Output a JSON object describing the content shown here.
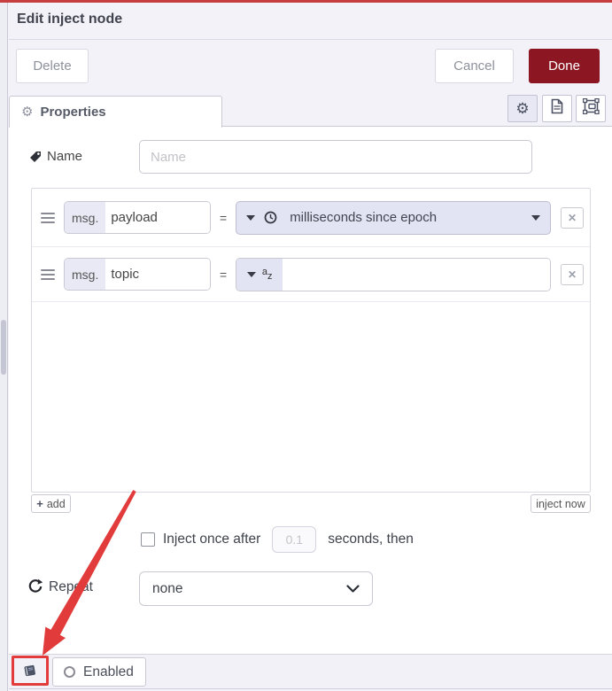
{
  "window": {
    "title": "Edit inject node"
  },
  "buttons": {
    "delete": "Delete",
    "cancel": "Cancel",
    "done": "Done"
  },
  "tab": {
    "label": "Properties"
  },
  "name_row": {
    "label": "Name",
    "placeholder": "Name"
  },
  "rules": {
    "rows": [
      {
        "prefix": "msg.",
        "property": "payload",
        "equals": "=",
        "type_label": "milliseconds since epoch"
      },
      {
        "prefix": "msg.",
        "property": "topic",
        "equals": "=",
        "value": ""
      }
    ],
    "remove_glyph": "✕",
    "plus_glyph": "+",
    "add_label": "add",
    "inject_now_label": "inject now",
    "az_top": "a",
    "az_bottom": "z",
    "gear_glyph": "⚙"
  },
  "inject_once": {
    "label_before": "Inject once after",
    "delay_value": "0.1",
    "label_after": "seconds, then"
  },
  "repeat": {
    "label": "Repeat",
    "selected": "none"
  },
  "footer": {
    "enabled_label": "Enabled"
  },
  "icons": [
    "gear-icon",
    "document-icon",
    "appearance-icon",
    "tag-icon",
    "clock-icon",
    "az-icon",
    "repeat-icon",
    "book-icon",
    "radio-circle-icon",
    "drag-handle-icon",
    "caret-down-icon",
    "chevron-down-icon"
  ],
  "colors": {
    "top_bar_red": "#c73d40",
    "annotation_red": "#e13b3b",
    "done_bg": "#8c1722",
    "typed_input_bg": "#e2e3f3"
  }
}
